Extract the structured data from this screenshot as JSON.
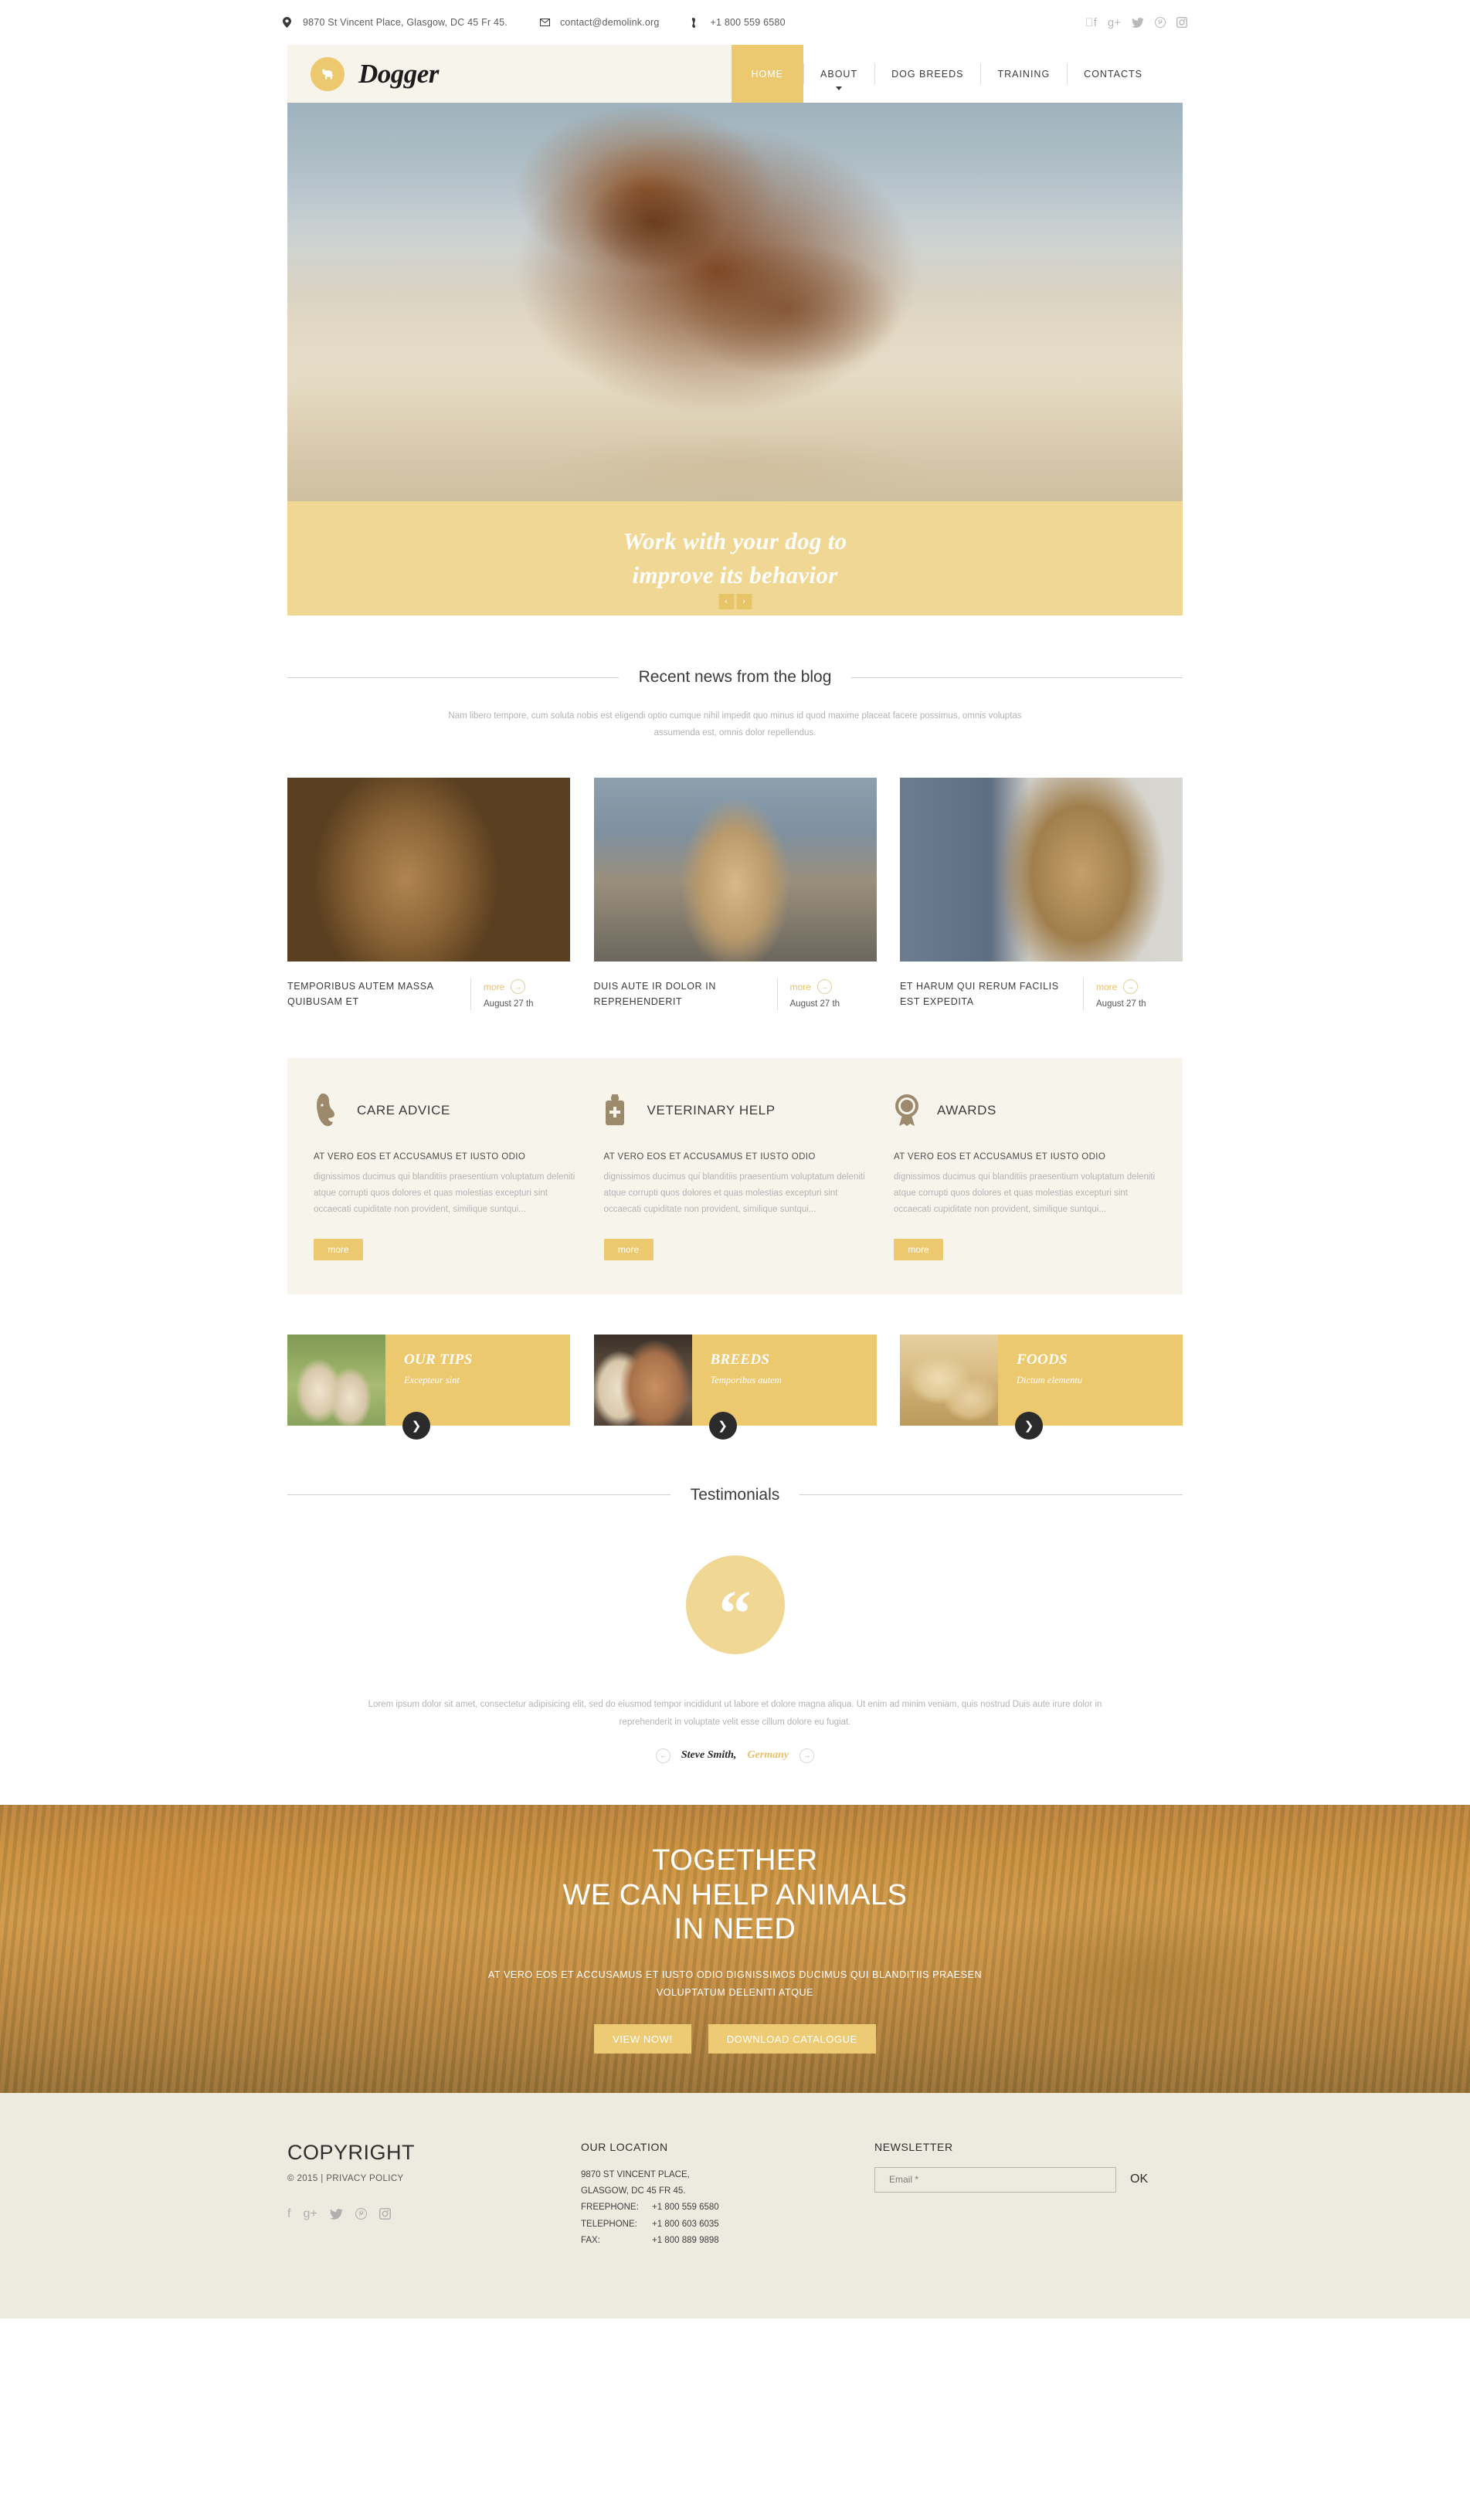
{
  "topbar": {
    "address": "9870 St Vincent Place, Glasgow, DC 45 Fr 45.",
    "email": "contact@demolink.org",
    "phone": "+1 800 559 6580",
    "socials": [
      "facebook-icon",
      "google-plus-icon",
      "twitter-icon",
      "pinterest-icon",
      "instagram-icon"
    ]
  },
  "header": {
    "logo_text": "Dogger",
    "nav": [
      {
        "label": "HOME",
        "active": true
      },
      {
        "label": "ABOUT",
        "active": false,
        "has_caret": true
      },
      {
        "label": "DOG BREEDS",
        "active": false
      },
      {
        "label": "TRAINING",
        "active": false
      },
      {
        "label": "CONTACTS",
        "active": false
      }
    ]
  },
  "hero": {
    "title_line1": "Work with your dog to",
    "title_line2": "improve its behavior",
    "prev": "‹",
    "next": "›"
  },
  "blog": {
    "section_title": "Recent news from the blog",
    "section_sub": "Nam libero tempore, cum soluta nobis est eligendi optio cumque nihil impedit quo minus id quod maxime placeat facere possimus, omnis voluptas assumenda est, omnis dolor repellendus.",
    "posts": [
      {
        "title": "TEMPORIBUS AUTEM MASSA QUIBUSAM ET",
        "more": "more",
        "date": "August 27 th"
      },
      {
        "title": "DUIS AUTE IR DOLOR IN REPREHENDERIT",
        "more": "more",
        "date": "August 27 th"
      },
      {
        "title": "ET HARUM QUI RERUM FACILIS EST EXPEDITA",
        "more": "more",
        "date": "August 27 th"
      }
    ]
  },
  "services": [
    {
      "icon": "dog-head-icon",
      "name": "CARE ADVICE",
      "lead": "AT VERO EOS ET ACCUSAMUS ET IUSTO ODIO",
      "body": "dignissimos ducimus qui blanditiis praesentium voluptatum deleniti atque corrupti quos dolores et quas molestias excepturi sint occaecati cupiditate non provident, similique suntqui...",
      "button": "more"
    },
    {
      "icon": "first-aid-kit-icon",
      "name": "VETERINARY HELP",
      "lead": "AT VERO EOS ET ACCUSAMUS ET IUSTO ODIO",
      "body": "dignissimos ducimus qui blanditiis praesentium voluptatum deleniti atque corrupti quos dolores et quas molestias excepturi sint occaecati cupiditate non provident, similique suntqui...",
      "button": "more"
    },
    {
      "icon": "award-rosette-icon",
      "name": "AWARDS",
      "lead": "AT VERO EOS ET ACCUSAMUS ET IUSTO ODIO",
      "body": "dignissimos ducimus qui blanditiis praesentium voluptatum deleniti atque corrupti quos dolores et quas molestias excepturi sint occaecati cupiditate non provident, similique suntqui...",
      "button": "more"
    }
  ],
  "tiles": [
    {
      "title": "OUR TIPS",
      "subtitle": "Excepteur sint",
      "arrow": "❯"
    },
    {
      "title": "BREEDS",
      "subtitle": "Temporibus autem",
      "arrow": "❯"
    },
    {
      "title": "FOODS",
      "subtitle": "Dictum elementu",
      "arrow": "❯"
    }
  ],
  "testimonials": {
    "section_title": "Testimonials",
    "quote_glyph": "“",
    "text": "Lorem ipsum dolor sit amet, consectetur adipisicing elit, sed do eiusmod tempor incididunt ut labore et dolore magna aliqua. Ut enim ad minim veniam, quis nostrud Duis aute irure dolor in reprehenderit in voluptate velit esse cillum dolore eu fugiat.",
    "author_name": "Steve Smith,",
    "author_country": "Germany",
    "prev": "←",
    "next": "→"
  },
  "cta": {
    "line1": "TOGETHER",
    "line2": "WE CAN HELP ANIMALS",
    "line3": "IN NEED",
    "sub_line1": "AT VERO EOS ET ACCUSAMUS ET IUSTO ODIO DIGNISSIMOS DUCIMUS QUI BLANDITIIS PRAESEN",
    "sub_line2": "VOLUPTATUM DELENITI ATQUE",
    "btn_view": "VIEW NOW!",
    "btn_download": "DOWNLOAD CATALOGUE"
  },
  "footer": {
    "copyright": "COPYRIGHT",
    "policy": "© 2015 | PRIVACY POLICY",
    "socials": [
      "facebook-icon",
      "google-plus-icon",
      "twitter-icon",
      "pinterest-icon",
      "instagram-icon"
    ],
    "location_head": "OUR LOCATION",
    "address_line1": "9870 ST VINCENT PLACE,",
    "address_line2": "GLASGOW, DC 45 FR 45.",
    "freephone_label": "FREEPHONE:",
    "freephone_value": "+1 800 559 6580",
    "telephone_label": "TELEPHONE:",
    "telephone_value": "+1 800 603 6035",
    "fax_label": "FAX:",
    "fax_value": "+1 800 889 9898",
    "newsletter_head": "NEWSLETTER",
    "email_placeholder": "Email *",
    "ok_label": "OK"
  },
  "colors": {
    "accent": "#ecc96e",
    "accent_light": "#f0d794",
    "panel": "#f7f4ec",
    "footer_bg": "#edeadf"
  }
}
